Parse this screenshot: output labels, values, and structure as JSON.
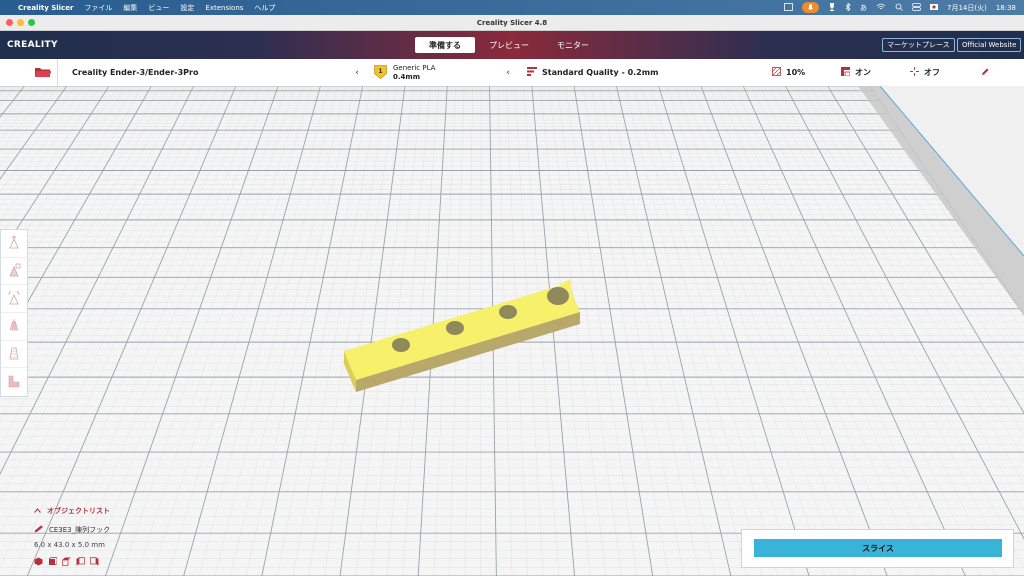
{
  "menubar": {
    "app_name": "Creality Slicer",
    "items": [
      "ファイル",
      "編集",
      "ビュー",
      "設定",
      "Extensions",
      "ヘルプ"
    ],
    "ime": "あ",
    "date": "7月14日(火)",
    "time": "18:38"
  },
  "window": {
    "title": "Creality Slicer 4.8"
  },
  "header": {
    "logo": "CREALITY",
    "stages": [
      "準備する",
      "プレビュー",
      "モニター"
    ],
    "active_stage": 0,
    "marketplace_label": "マーケットプレース",
    "website_label": "Official Website"
  },
  "toolbar": {
    "printer": "Creality Ender-3/Ender-3Pro",
    "material_name": "Generic PLA",
    "nozzle": "0.4mm",
    "quality": "Standard Quality - 0.2mm",
    "infill": "10%",
    "support": "オン",
    "adhesion": "オフ"
  },
  "objects": {
    "header": "オブジェクトリスト",
    "name": "CE3E3_陳列フック",
    "dimensions": "6.0 x 43.0 x 5.0 mm"
  },
  "slice": {
    "label": "スライス"
  },
  "colors": {
    "accent": "#b5313d",
    "slice_button": "#39b4d8",
    "model": "#f7f06a"
  }
}
